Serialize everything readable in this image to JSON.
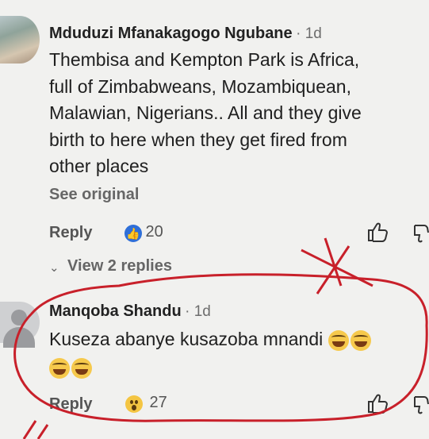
{
  "comments": [
    {
      "author": "Mduduzi Mfanakagogo Ngubane",
      "time": "· 1d",
      "text_lines": [
        "Thembisa and Kempton Park is Africa,",
        "full of Zimbabweans, Mozambiquean,",
        "Malawian, Nigerians.. All and they give",
        "birth to here when they get fired from",
        "other places"
      ],
      "see_original": "See original",
      "reply_label": "Reply",
      "reaction_icon": "like-icon",
      "reaction_count": "20",
      "view_replies": "View 2 replies"
    },
    {
      "author": "Manqoba Shandu",
      "time": "· 1d",
      "text_lines": [
        "Kuseza abanye kusazoba mnandi"
      ],
      "reply_label": "Reply",
      "reaction_icon": "wow-icon",
      "reaction_count": "27"
    }
  ],
  "colors": {
    "like_blue": "#2f6fd8",
    "annotation_red": "#c8202a"
  }
}
